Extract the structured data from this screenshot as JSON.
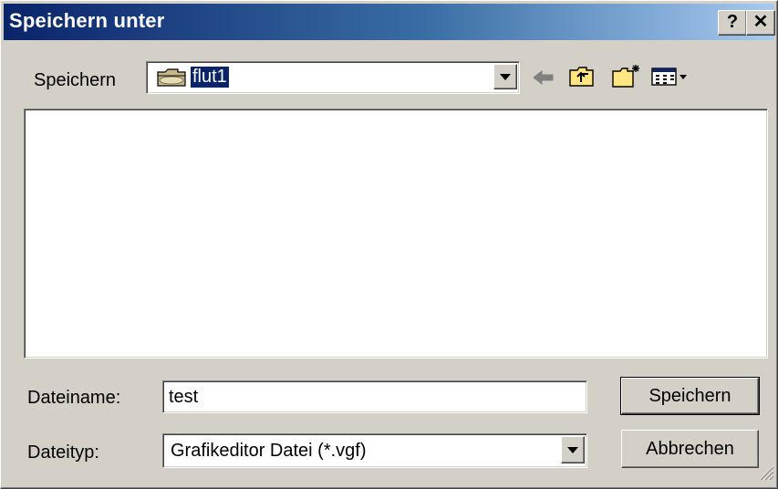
{
  "dialog": {
    "title": "Speichern unter",
    "help_label": "?",
    "close_label": "✕"
  },
  "location": {
    "label": "Speichern",
    "folder": "flut1"
  },
  "toolbar": {
    "icons": [
      "back-icon",
      "up-folder-icon",
      "new-folder-icon",
      "view-menu-icon"
    ]
  },
  "filename": {
    "label": "Dateiname:",
    "value": "test"
  },
  "filetype": {
    "label": "Dateityp:",
    "value": "Grafikeditor Datei (*.vgf)"
  },
  "buttons": {
    "save_label": "Speichern",
    "cancel_label": "Abbrechen"
  },
  "colors": {
    "title_start": "#0a246a",
    "title_end": "#a6caf0",
    "face": "#d4d0c8"
  }
}
